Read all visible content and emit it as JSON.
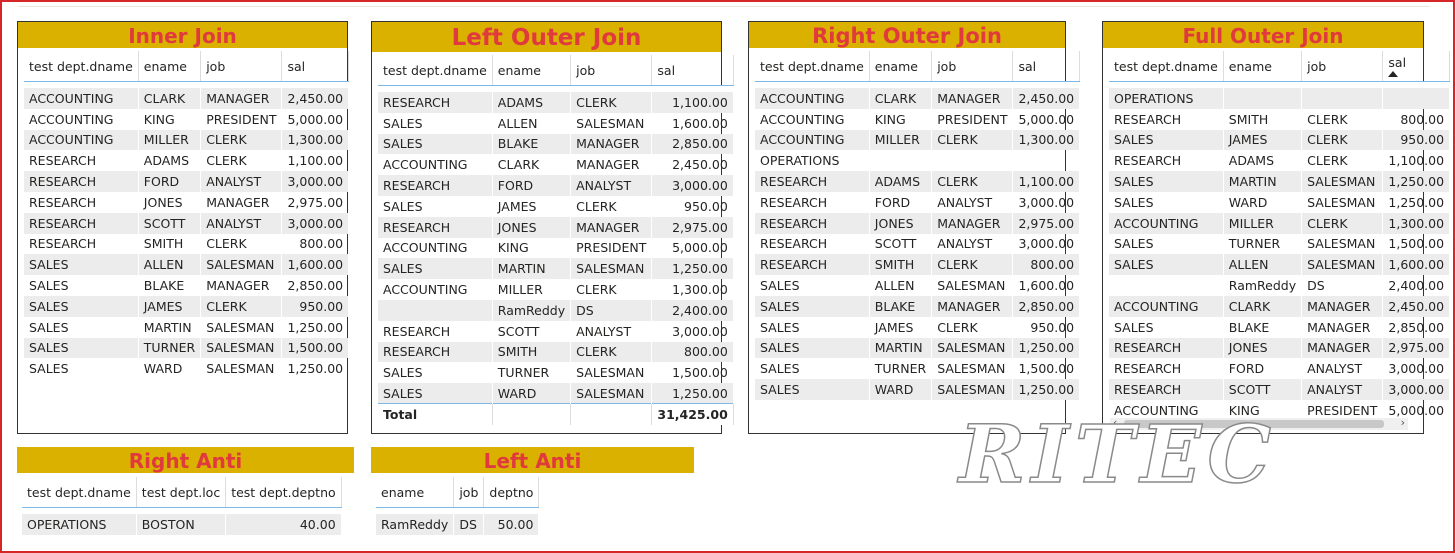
{
  "inner_join": {
    "title": "Inner Join",
    "columns": [
      "test dept.dname",
      "ename",
      "job",
      "sal"
    ],
    "rows": [
      [
        "ACCOUNTING",
        "CLARK",
        "MANAGER",
        "2,450.00"
      ],
      [
        "ACCOUNTING",
        "KING",
        "PRESIDENT",
        "5,000.00"
      ],
      [
        "ACCOUNTING",
        "MILLER",
        "CLERK",
        "1,300.00"
      ],
      [
        "RESEARCH",
        "ADAMS",
        "CLERK",
        "1,100.00"
      ],
      [
        "RESEARCH",
        "FORD",
        "ANALYST",
        "3,000.00"
      ],
      [
        "RESEARCH",
        "JONES",
        "MANAGER",
        "2,975.00"
      ],
      [
        "RESEARCH",
        "SCOTT",
        "ANALYST",
        "3,000.00"
      ],
      [
        "RESEARCH",
        "SMITH",
        "CLERK",
        "800.00"
      ],
      [
        "SALES",
        "ALLEN",
        "SALESMAN",
        "1,600.00"
      ],
      [
        "SALES",
        "BLAKE",
        "MANAGER",
        "2,850.00"
      ],
      [
        "SALES",
        "JAMES",
        "CLERK",
        "950.00"
      ],
      [
        "SALES",
        "MARTIN",
        "SALESMAN",
        "1,250.00"
      ],
      [
        "SALES",
        "TURNER",
        "SALESMAN",
        "1,500.00"
      ],
      [
        "SALES",
        "WARD",
        "SALESMAN",
        "1,250.00"
      ]
    ]
  },
  "left_outer_join": {
    "title": "Left Outer Join",
    "columns": [
      "test dept.dname",
      "ename",
      "job",
      "sal"
    ],
    "rows": [
      [
        "RESEARCH",
        "ADAMS",
        "CLERK",
        "1,100.00"
      ],
      [
        "SALES",
        "ALLEN",
        "SALESMAN",
        "1,600.00"
      ],
      [
        "SALES",
        "BLAKE",
        "MANAGER",
        "2,850.00"
      ],
      [
        "ACCOUNTING",
        "CLARK",
        "MANAGER",
        "2,450.00"
      ],
      [
        "RESEARCH",
        "FORD",
        "ANALYST",
        "3,000.00"
      ],
      [
        "SALES",
        "JAMES",
        "CLERK",
        "950.00"
      ],
      [
        "RESEARCH",
        "JONES",
        "MANAGER",
        "2,975.00"
      ],
      [
        "ACCOUNTING",
        "KING",
        "PRESIDENT",
        "5,000.00"
      ],
      [
        "SALES",
        "MARTIN",
        "SALESMAN",
        "1,250.00"
      ],
      [
        "ACCOUNTING",
        "MILLER",
        "CLERK",
        "1,300.00"
      ],
      [
        "",
        "RamReddy",
        "DS",
        "2,400.00"
      ],
      [
        "RESEARCH",
        "SCOTT",
        "ANALYST",
        "3,000.00"
      ],
      [
        "RESEARCH",
        "SMITH",
        "CLERK",
        "800.00"
      ],
      [
        "SALES",
        "TURNER",
        "SALESMAN",
        "1,500.00"
      ],
      [
        "SALES",
        "WARD",
        "SALESMAN",
        "1,250.00"
      ]
    ],
    "total_label": "Total",
    "total_value": "31,425.00"
  },
  "right_outer_join": {
    "title": "Right Outer Join",
    "columns": [
      "test dept.dname",
      "ename",
      "job",
      "sal"
    ],
    "rows": [
      [
        "ACCOUNTING",
        "CLARK",
        "MANAGER",
        "2,450.00"
      ],
      [
        "ACCOUNTING",
        "KING",
        "PRESIDENT",
        "5,000.00"
      ],
      [
        "ACCOUNTING",
        "MILLER",
        "CLERK",
        "1,300.00"
      ],
      [
        "OPERATIONS",
        "",
        "",
        ""
      ],
      [
        "RESEARCH",
        "ADAMS",
        "CLERK",
        "1,100.00"
      ],
      [
        "RESEARCH",
        "FORD",
        "ANALYST",
        "3,000.00"
      ],
      [
        "RESEARCH",
        "JONES",
        "MANAGER",
        "2,975.00"
      ],
      [
        "RESEARCH",
        "SCOTT",
        "ANALYST",
        "3,000.00"
      ],
      [
        "RESEARCH",
        "SMITH",
        "CLERK",
        "800.00"
      ],
      [
        "SALES",
        "ALLEN",
        "SALESMAN",
        "1,600.00"
      ],
      [
        "SALES",
        "BLAKE",
        "MANAGER",
        "2,850.00"
      ],
      [
        "SALES",
        "JAMES",
        "CLERK",
        "950.00"
      ],
      [
        "SALES",
        "MARTIN",
        "SALESMAN",
        "1,250.00"
      ],
      [
        "SALES",
        "TURNER",
        "SALESMAN",
        "1,500.00"
      ],
      [
        "SALES",
        "WARD",
        "SALESMAN",
        "1,250.00"
      ]
    ]
  },
  "full_outer_join": {
    "title": "Full Outer Join",
    "columns": [
      "test dept.dname",
      "ename",
      "job",
      "sal"
    ],
    "rows": [
      [
        "OPERATIONS",
        "",
        "",
        ""
      ],
      [
        "RESEARCH",
        "SMITH",
        "CLERK",
        "800.00"
      ],
      [
        "SALES",
        "JAMES",
        "CLERK",
        "950.00"
      ],
      [
        "RESEARCH",
        "ADAMS",
        "CLERK",
        "1,100.00"
      ],
      [
        "SALES",
        "MARTIN",
        "SALESMAN",
        "1,250.00"
      ],
      [
        "SALES",
        "WARD",
        "SALESMAN",
        "1,250.00"
      ],
      [
        "ACCOUNTING",
        "MILLER",
        "CLERK",
        "1,300.00"
      ],
      [
        "SALES",
        "TURNER",
        "SALESMAN",
        "1,500.00"
      ],
      [
        "SALES",
        "ALLEN",
        "SALESMAN",
        "1,600.00"
      ],
      [
        "",
        "RamReddy",
        "DS",
        "2,400.00"
      ],
      [
        "ACCOUNTING",
        "CLARK",
        "MANAGER",
        "2,450.00"
      ],
      [
        "SALES",
        "BLAKE",
        "MANAGER",
        "2,850.00"
      ],
      [
        "RESEARCH",
        "JONES",
        "MANAGER",
        "2,975.00"
      ],
      [
        "RESEARCH",
        "FORD",
        "ANALYST",
        "3,000.00"
      ],
      [
        "RESEARCH",
        "SCOTT",
        "ANALYST",
        "3,000.00"
      ],
      [
        "ACCOUNTING",
        "KING",
        "PRESIDENT",
        "5,000.00"
      ]
    ],
    "sort_icon": "sort-ascending-icon",
    "scroll_left_icon": "‹",
    "scroll_right_icon": "›"
  },
  "right_anti": {
    "title": "Right Anti",
    "columns": [
      "test dept.dname",
      "test dept.loc",
      "test dept.deptno"
    ],
    "rows": [
      [
        "OPERATIONS",
        "BOSTON",
        "40.00"
      ]
    ]
  },
  "left_anti": {
    "title": "Left Anti",
    "columns": [
      "ename",
      "job",
      "deptno"
    ],
    "rows": [
      [
        "RamReddy",
        "DS",
        "50.00"
      ]
    ]
  },
  "watermark": {
    "text": "RITEC"
  },
  "colors": {
    "header_bg": "#dbb100",
    "header_text": "#e0393e",
    "frame": "#d62728",
    "column_rule": "#7db9e6"
  }
}
